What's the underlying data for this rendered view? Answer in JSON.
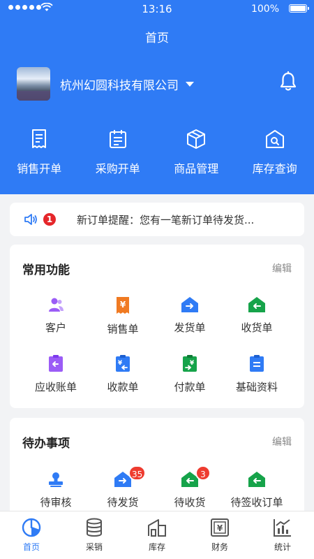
{
  "status_bar": {
    "time": "13:16",
    "battery": "100%"
  },
  "nav": {
    "title": "首页"
  },
  "company": {
    "name": "杭州幻圆科技有限公司"
  },
  "top_actions": [
    {
      "label": "销售开单",
      "icon": "receipt-icon"
    },
    {
      "label": "采购开单",
      "icon": "calendar-form-icon"
    },
    {
      "label": "商品管理",
      "icon": "package-icon"
    },
    {
      "label": "库存查询",
      "icon": "warehouse-search-icon"
    }
  ],
  "notice": {
    "count": "1",
    "text": "新订单提醒：您有一笔新订单待发货..."
  },
  "common": {
    "title": "常用功能",
    "edit": "编辑",
    "items": [
      {
        "label": "客户",
        "icon": "customer-icon",
        "color": "#9b5cf6"
      },
      {
        "label": "销售单",
        "icon": "sales-order-icon",
        "color": "#f07a22"
      },
      {
        "label": "发货单",
        "icon": "shipping-icon",
        "color": "#2f7bf5"
      },
      {
        "label": "收货单",
        "icon": "receiving-icon",
        "color": "#16a34a"
      },
      {
        "label": "应收账单",
        "icon": "receivable-icon",
        "color": "#9b5cf6"
      },
      {
        "label": "收款单",
        "icon": "collection-icon",
        "color": "#2f7bf5"
      },
      {
        "label": "付款单",
        "icon": "payment-icon",
        "color": "#16a34a"
      },
      {
        "label": "基础资料",
        "icon": "document-icon",
        "color": "#2f7bf5"
      }
    ]
  },
  "todo": {
    "title": "待办事项",
    "edit": "编辑",
    "items": [
      {
        "label": "待审核",
        "icon": "approve-stamp-icon",
        "color": "#2f7bf5",
        "count": ""
      },
      {
        "label": "待发货",
        "icon": "shipping-icon",
        "color": "#2f7bf5",
        "count": "35"
      },
      {
        "label": "待收货",
        "icon": "receiving-icon",
        "color": "#16a34a",
        "count": "3"
      },
      {
        "label": "待签收订单",
        "icon": "receiving-icon",
        "color": "#16a34a",
        "count": ""
      }
    ]
  },
  "tabs": [
    {
      "label": "首页",
      "icon": "home-pie-icon",
      "active": true
    },
    {
      "label": "采销",
      "icon": "database-icon",
      "active": false
    },
    {
      "label": "库存",
      "icon": "warehouse-icon",
      "active": false
    },
    {
      "label": "财务",
      "icon": "finance-icon",
      "active": false
    },
    {
      "label": "统计",
      "icon": "statistics-icon",
      "active": false
    }
  ],
  "colors": {
    "primary": "#2f7bf5",
    "badge": "#e5262a"
  }
}
